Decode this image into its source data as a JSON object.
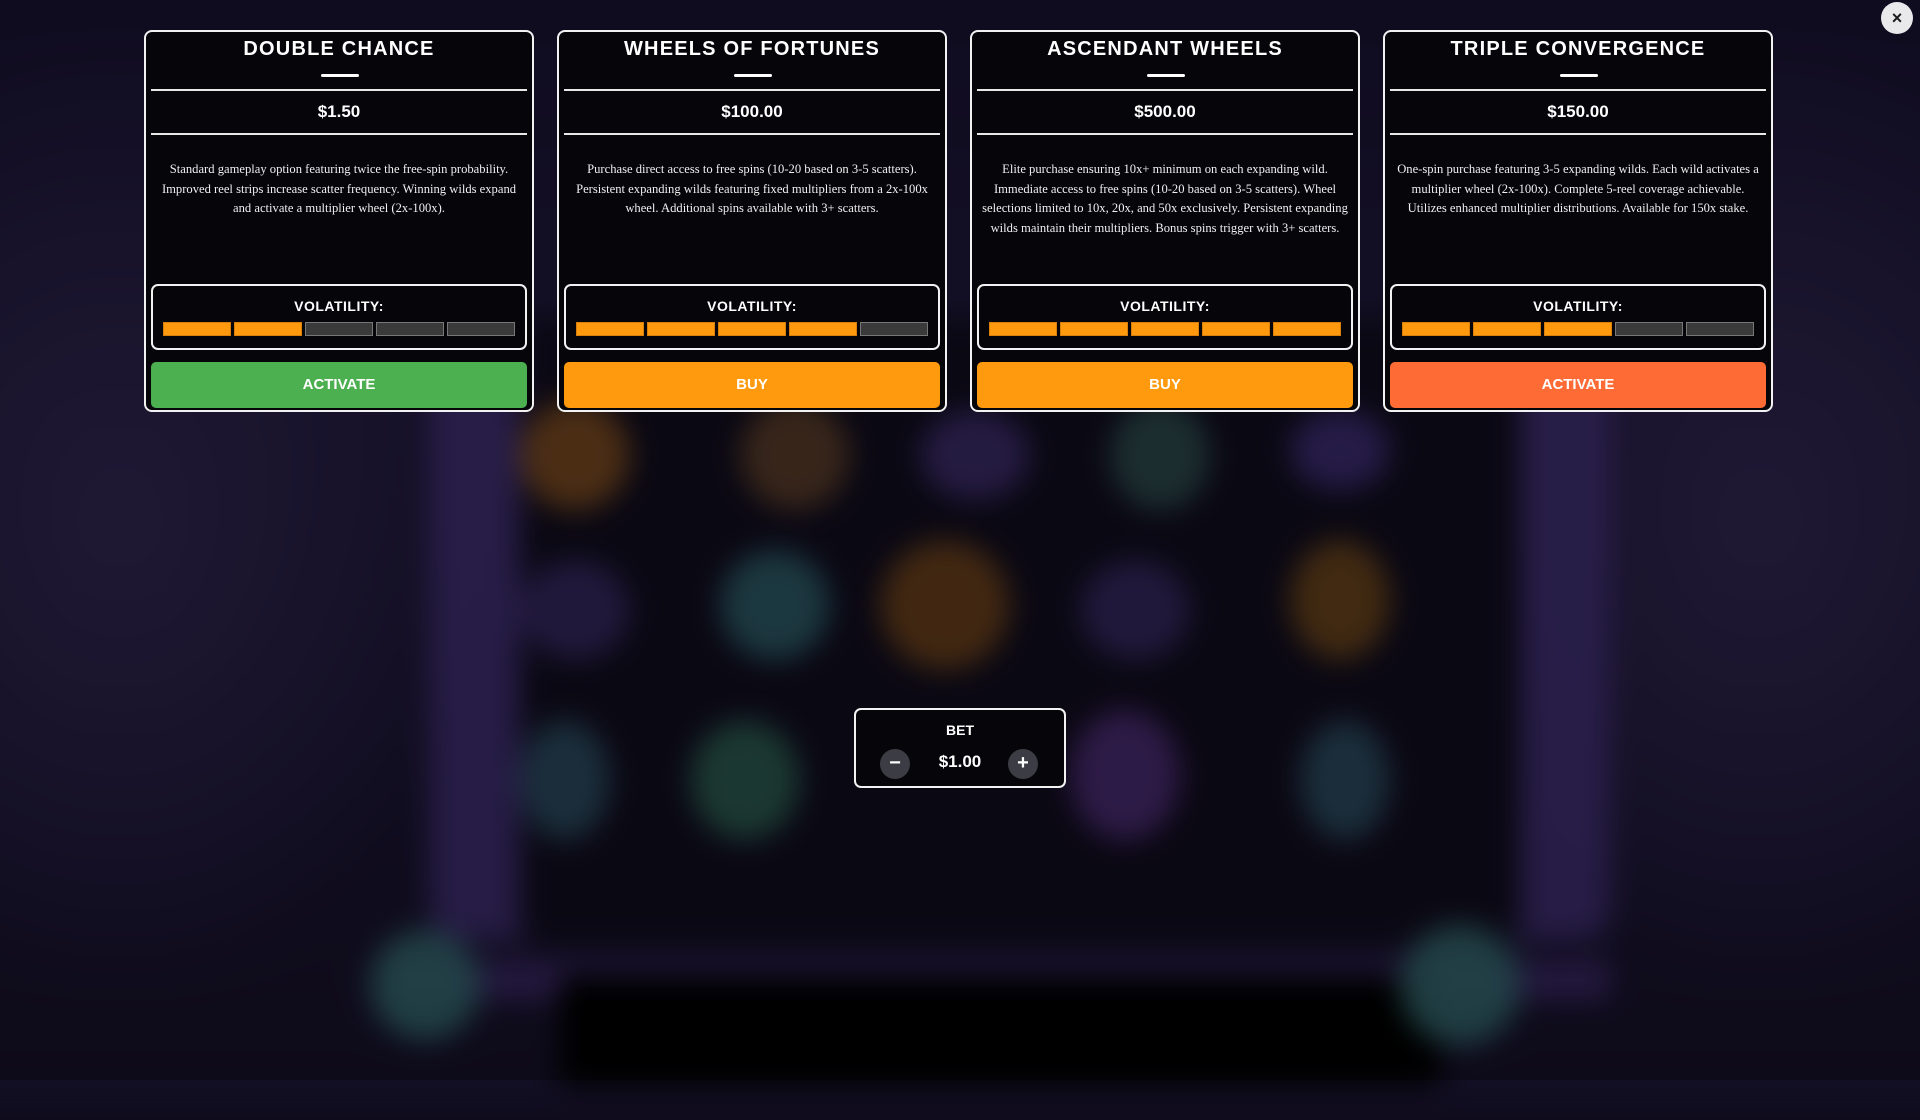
{
  "colors": {
    "orange": "#ff9a0f",
    "green": "#4caf50",
    "red_orange": "#ff6b35",
    "inactive_segment": "#3a3a3a"
  },
  "close": {
    "icon": "close-icon",
    "glyph": "×"
  },
  "cards": [
    {
      "title": "Double Chance",
      "price": "$1.50",
      "description": "Standard gameplay option featuring twice the free-spin probability. Improved reel strips increase scatter frequency. Winning wilds expand and activate a multiplier wheel (2x-100x).",
      "volatility_label": "VOLATILITY:",
      "volatility_level": 2,
      "volatility_max": 5,
      "button": "Activate",
      "button_color": "#4caf50"
    },
    {
      "title": "Wheels of Fortunes",
      "price": "$100.00",
      "description": "Purchase direct access to free spins (10-20 based on 3-5 scatters). Persistent expanding wilds featuring fixed multipliers from a 2x-100x wheel. Additional spins available with 3+ scatters.",
      "volatility_label": "VOLATILITY:",
      "volatility_level": 4,
      "volatility_max": 5,
      "button": "Buy",
      "button_color": "#ff9a0f"
    },
    {
      "title": "Ascendant Wheels",
      "price": "$500.00",
      "description": "Elite purchase ensuring 10x+ minimum on each expanding wild. Immediate access to free spins (10-20 based on 3-5 scatters). Wheel selections limited to 10x, 20x, and 50x exclusively. Persistent expanding wilds maintain their multipliers. Bonus spins trigger with 3+ scatters.",
      "volatility_label": "VOLATILITY:",
      "volatility_level": 5,
      "volatility_max": 5,
      "button": "Buy",
      "button_color": "#ff9a0f"
    },
    {
      "title": "Triple Convergence",
      "price": "$150.00",
      "description": "One-spin purchase featuring 3-5 expanding wilds. Each wild activates a multiplier wheel (2x-100x). Complete 5-reel coverage achievable. Utilizes enhanced multiplier distributions. Available for 150x stake.",
      "volatility_label": "VOLATILITY:",
      "volatility_level": 3,
      "volatility_max": 5,
      "button": "Activate",
      "button_color": "#ff6b35"
    }
  ],
  "bet": {
    "label": "BET",
    "value": "$1.00",
    "minus_glyph": "−",
    "plus_glyph": "+",
    "minus_icon": "minus-icon",
    "plus_icon": "plus-icon"
  }
}
